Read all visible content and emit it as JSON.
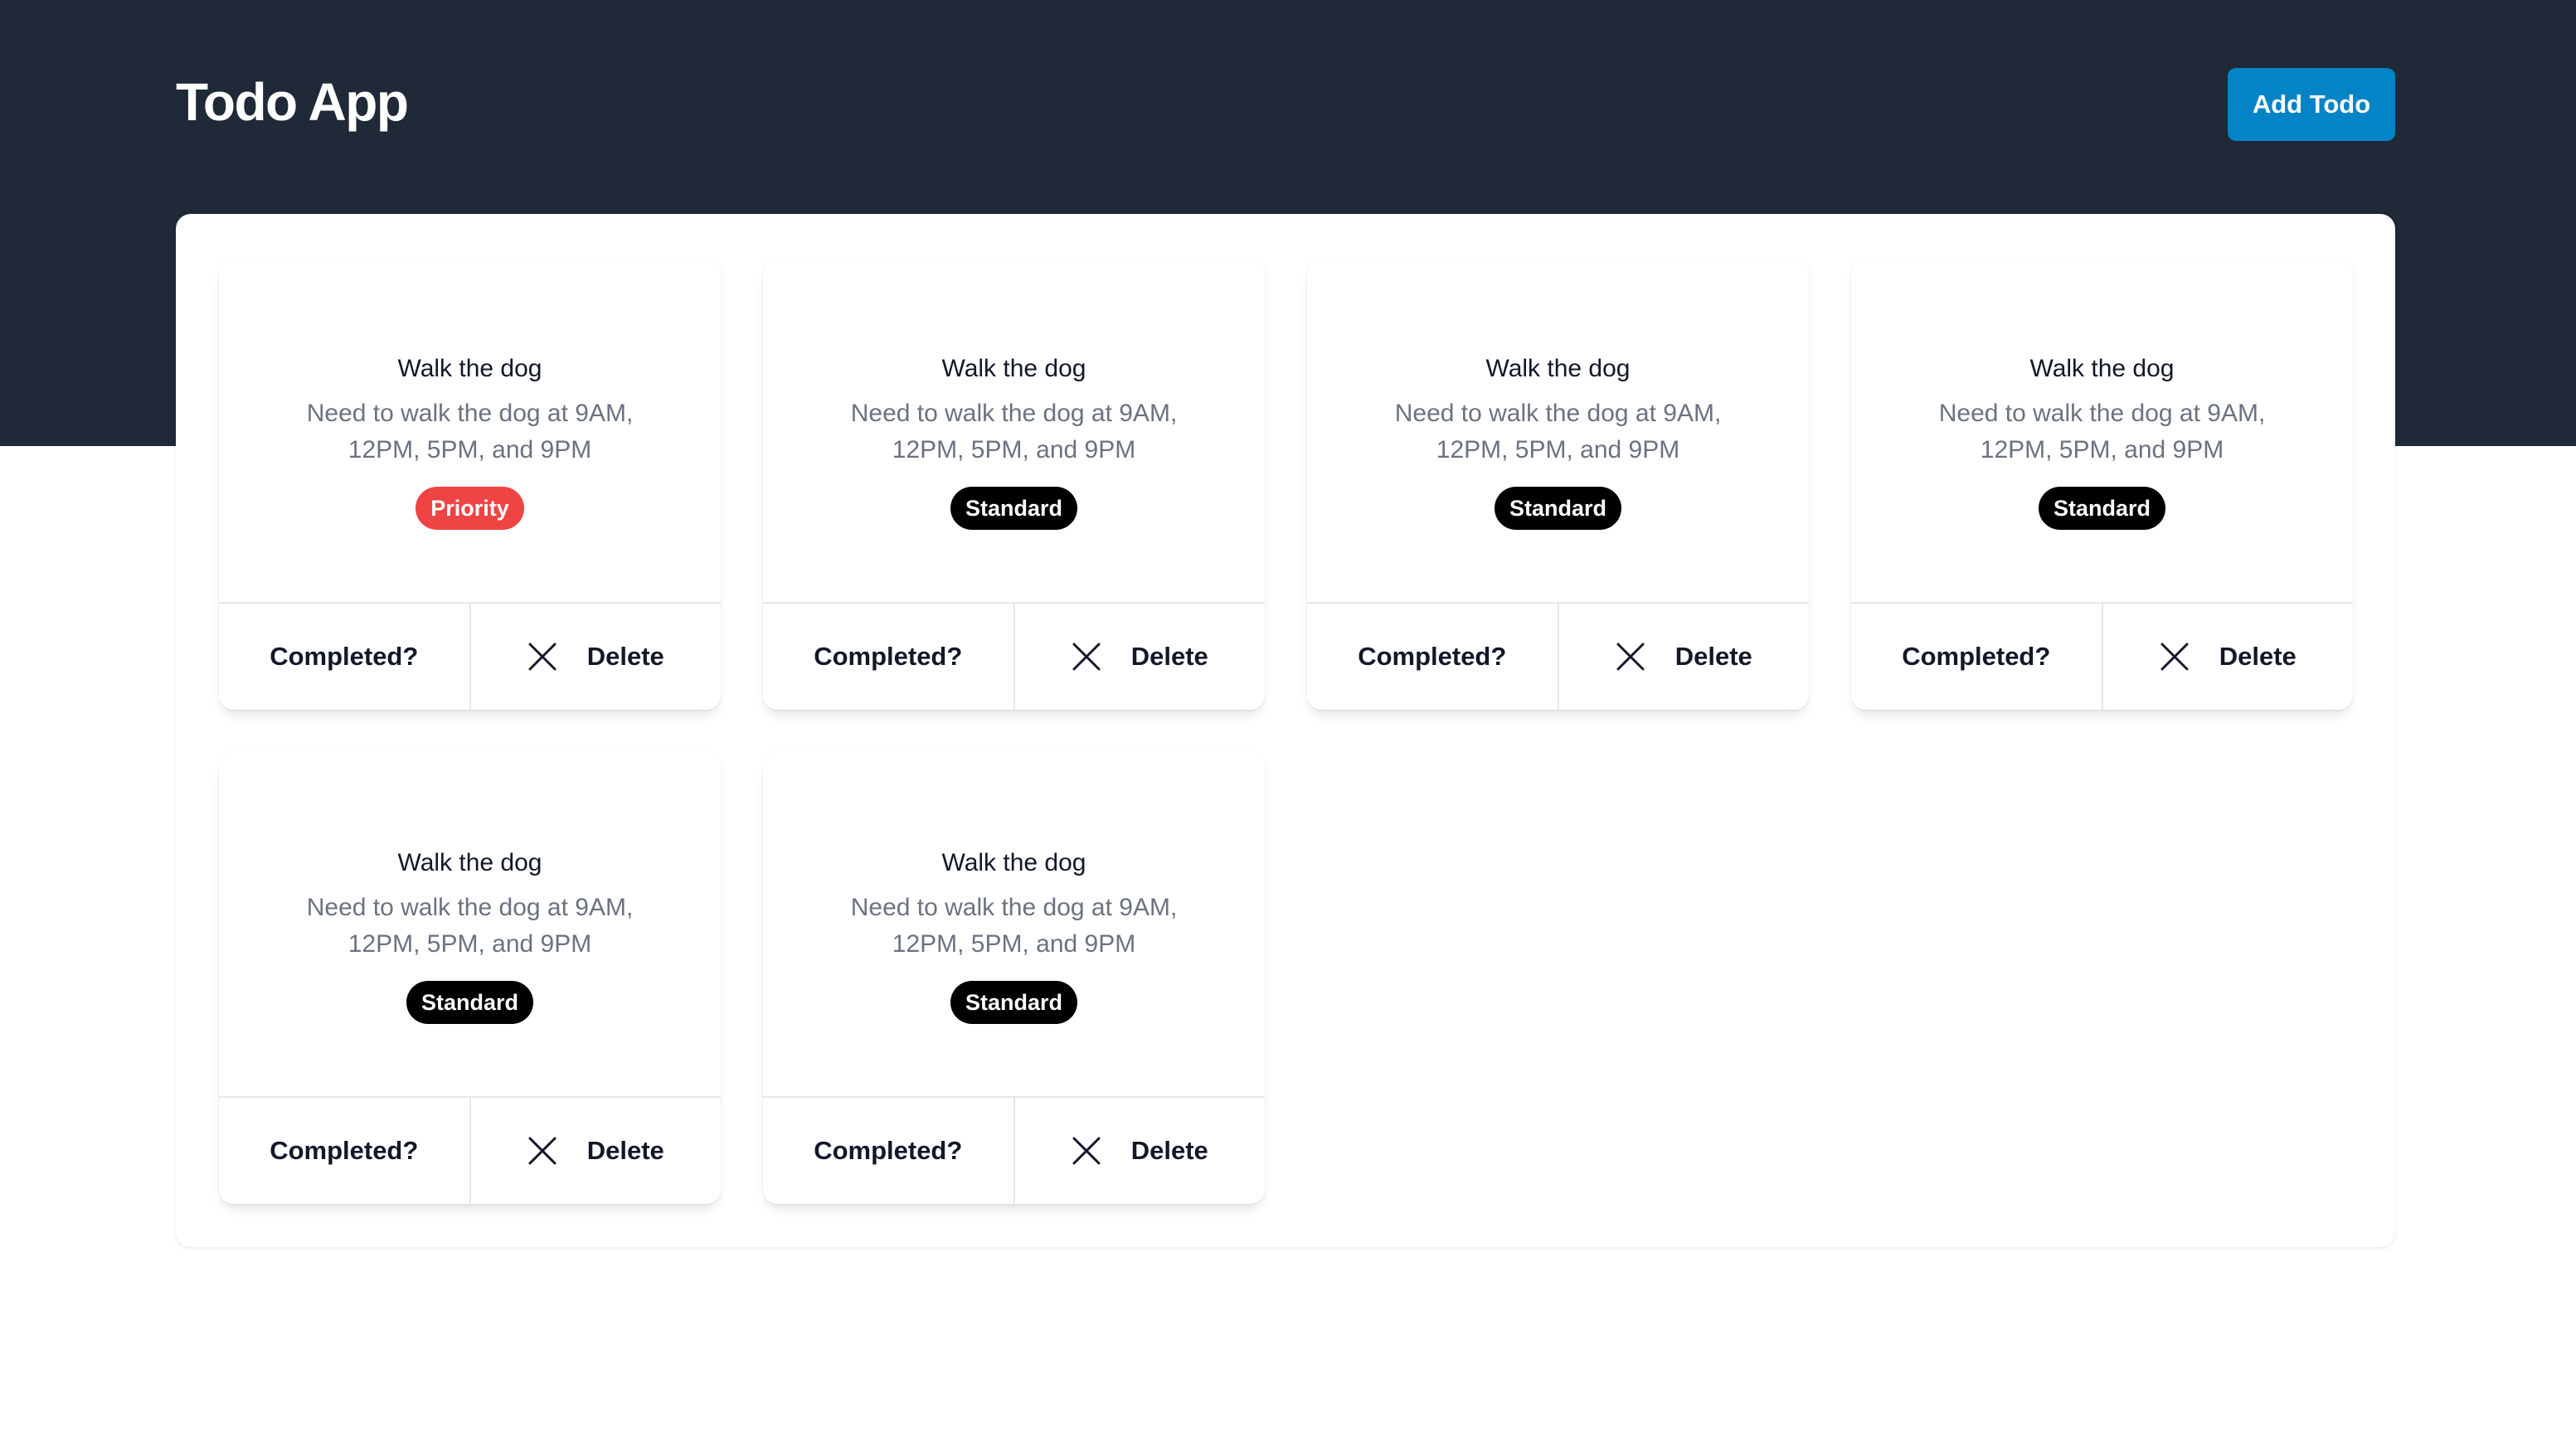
{
  "header": {
    "title": "Todo App",
    "add_button_label": "Add Todo"
  },
  "colors": {
    "header_bg": "#1f2937",
    "primary_button": "#0284c7",
    "priority_badge": "#ef4444",
    "standard_badge": "#000000"
  },
  "todos": [
    {
      "title": "Walk the dog",
      "description": "Need to walk the dog at 9AM, 12PM, 5PM, and 9PM",
      "badge": "Priority",
      "badge_type": "priority",
      "complete_label": "Completed?",
      "delete_label": "Delete",
      "delete_icon": "x-icon"
    },
    {
      "title": "Walk the dog",
      "description": "Need to walk the dog at 9AM, 12PM, 5PM, and 9PM",
      "badge": "Standard",
      "badge_type": "standard",
      "complete_label": "Completed?",
      "delete_label": "Delete",
      "delete_icon": "x-icon"
    },
    {
      "title": "Walk the dog",
      "description": "Need to walk the dog at 9AM, 12PM, 5PM, and 9PM",
      "badge": "Standard",
      "badge_type": "standard",
      "complete_label": "Completed?",
      "delete_label": "Delete",
      "delete_icon": "x-icon"
    },
    {
      "title": "Walk the dog",
      "description": "Need to walk the dog at 9AM, 12PM, 5PM, and 9PM",
      "badge": "Standard",
      "badge_type": "standard",
      "complete_label": "Completed?",
      "delete_label": "Delete",
      "delete_icon": "x-icon"
    },
    {
      "title": "Walk the dog",
      "description": "Need to walk the dog at 9AM, 12PM, 5PM, and 9PM",
      "badge": "Standard",
      "badge_type": "standard",
      "complete_label": "Completed?",
      "delete_label": "Delete",
      "delete_icon": "x-icon"
    },
    {
      "title": "Walk the dog",
      "description": "Need to walk the dog at 9AM, 12PM, 5PM, and 9PM",
      "badge": "Standard",
      "badge_type": "standard",
      "complete_label": "Completed?",
      "delete_label": "Delete",
      "delete_icon": "x-icon"
    }
  ]
}
